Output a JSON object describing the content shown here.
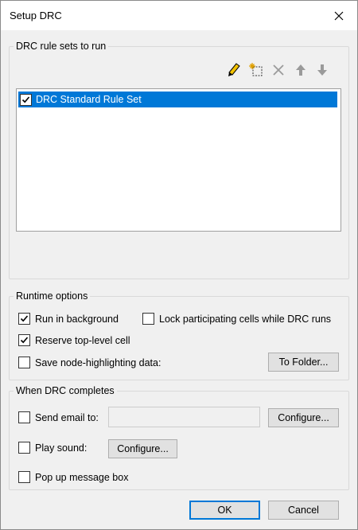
{
  "window": {
    "title": "Setup DRC"
  },
  "rule_sets": {
    "legend": "DRC rule sets to run",
    "toolbar_icons": [
      "edit-pencil-icon",
      "new-rule-set-icon",
      "delete-x-icon",
      "move-up-arrow-icon",
      "move-down-arrow-icon"
    ],
    "items": [
      {
        "label": "DRC Standard Rule Set",
        "checked": true,
        "selected": true
      }
    ]
  },
  "runtime": {
    "legend": "Runtime options",
    "run_in_background": {
      "label": "Run in background",
      "checked": true
    },
    "lock_cells": {
      "label": "Lock participating cells while DRC runs",
      "checked": false
    },
    "reserve_top_level": {
      "label": "Reserve top-level cell",
      "checked": true
    },
    "save_node_highlighting": {
      "label": "Save node-highlighting data:",
      "checked": false
    },
    "to_folder_label": "To Folder..."
  },
  "completion": {
    "legend": "When DRC completes",
    "send_email": {
      "label": "Send email to:",
      "checked": false,
      "value": ""
    },
    "email_configure_label": "Configure...",
    "play_sound": {
      "label": "Play sound:",
      "checked": false
    },
    "sound_configure_label": "Configure...",
    "popup": {
      "label": "Pop up message box",
      "checked": false
    }
  },
  "buttons": {
    "ok": "OK",
    "cancel": "Cancel"
  },
  "colors": {
    "selection": "#0078d7",
    "dialog_bg": "#f0f0f0"
  }
}
